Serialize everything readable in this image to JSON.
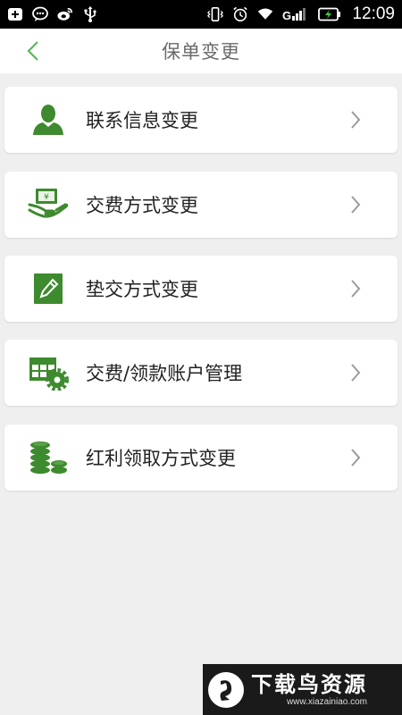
{
  "status_bar": {
    "time": "12:09",
    "left_icons": [
      "add-box-icon",
      "chat-bubble-icon",
      "weibo-icon",
      "usb-icon"
    ],
    "right_icons": [
      "vibrate-icon",
      "alarm-icon",
      "wifi-icon",
      "signal-icon",
      "battery-charging-icon"
    ],
    "signal_label": "G"
  },
  "header": {
    "title": "保单变更",
    "back_icon": "chevron-left-icon"
  },
  "menu": {
    "items": [
      {
        "label": "联系信息变更",
        "icon": "person-icon"
      },
      {
        "label": "交费方式变更",
        "icon": "money-hand-icon"
      },
      {
        "label": "垫交方式变更",
        "icon": "edit-note-icon"
      },
      {
        "label": "交费/领款账户管理",
        "icon": "table-gear-icon"
      },
      {
        "label": "红利领取方式变更",
        "icon": "coin-stack-icon"
      }
    ]
  },
  "watermark": {
    "title": "下载鸟资源",
    "url": "www.xiazainiao.com"
  },
  "colors": {
    "accent_green": "#3e8a2e",
    "background": "#efefef",
    "card": "#ffffff",
    "chevron": "#9a9a9a"
  }
}
